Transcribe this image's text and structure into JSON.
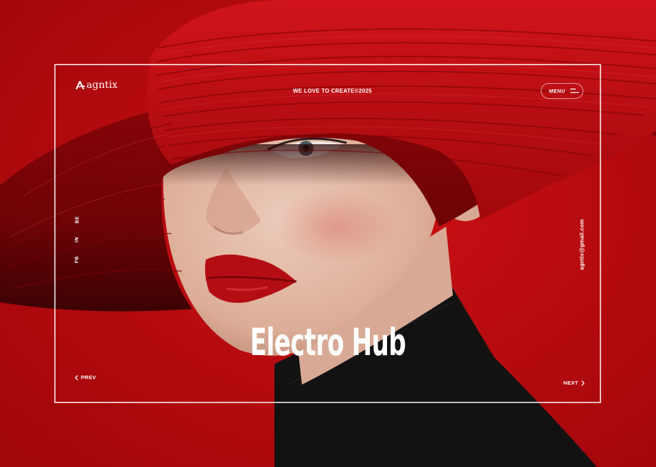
{
  "brand": {
    "name": "agntix",
    "logo_icon": "a-monogram-icon"
  },
  "header": {
    "tagline": "WE LOVE TO CREATE©2025"
  },
  "menu": {
    "label": "MENU",
    "icon": "hamburger-icon"
  },
  "social": {
    "links": [
      "FB",
      "IN",
      "BE"
    ]
  },
  "contact": {
    "email": "agntix@gmail.com"
  },
  "hero": {
    "title": "Electro Hub",
    "image": "woman-red-hat-black-turtleneck"
  },
  "nav": {
    "prev_label": "PREV",
    "next_label": "NEXT",
    "prev_icon": "chevron-left-icon",
    "next_icon": "chevron-right-icon"
  },
  "colors": {
    "background": "#b5080c",
    "hat": "#c20c10",
    "skin": "#e2b8a4",
    "lips": "#b40e14",
    "turtleneck": "#111111",
    "frame": "#ffffff"
  }
}
